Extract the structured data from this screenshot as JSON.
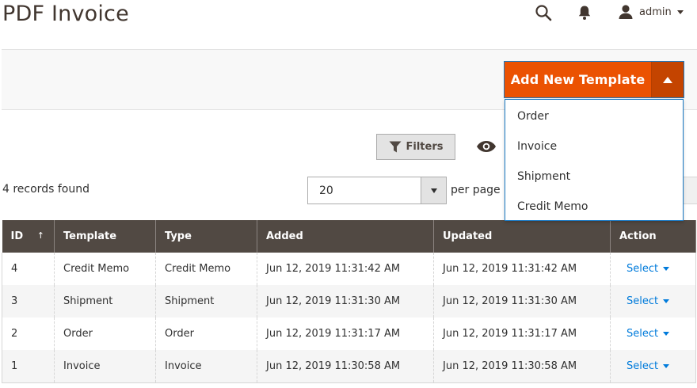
{
  "page": {
    "title": "PDF Invoice"
  },
  "header": {
    "search_icon": "search-icon",
    "notifications_icon": "bell-icon",
    "user": {
      "icon": "user-icon",
      "name": "admin"
    }
  },
  "add_template": {
    "label": "Add New Template",
    "menu": [
      "Order",
      "Invoice",
      "Shipment",
      "Credit Memo"
    ],
    "colors": {
      "button": "#eb5202",
      "toggle": "#c44400",
      "focus_border": "#1979c3"
    }
  },
  "filters": {
    "label": "Filters",
    "icon": "funnel-icon",
    "view_icon": "eye-icon"
  },
  "records": {
    "text": "4 records found"
  },
  "pagination": {
    "per_page_value": "20",
    "per_page_label": "per page"
  },
  "grid": {
    "columns": [
      "ID",
      "Template",
      "Type",
      "Added",
      "Updated",
      "Action"
    ],
    "sort_indicator": "↑",
    "header_color": "#514943",
    "link_color": "#007bdb",
    "rows": [
      {
        "id": "4",
        "template": "Credit Memo",
        "type": "Credit Memo",
        "added": "Jun 12, 2019 11:31:42 AM",
        "updated": "Jun 12, 2019 11:31:42 AM",
        "action": "Select"
      },
      {
        "id": "3",
        "template": "Shipment",
        "type": "Shipment",
        "added": "Jun 12, 2019 11:31:30 AM",
        "updated": "Jun 12, 2019 11:31:30 AM",
        "action": "Select"
      },
      {
        "id": "2",
        "template": "Order",
        "type": "Order",
        "added": "Jun 12, 2019 11:31:17 AM",
        "updated": "Jun 12, 2019 11:31:17 AM",
        "action": "Select"
      },
      {
        "id": "1",
        "template": "Invoice",
        "type": "Invoice",
        "added": "Jun 12, 2019 11:30:58 AM",
        "updated": "Jun 12, 2019 11:30:58 AM",
        "action": "Select"
      }
    ]
  }
}
